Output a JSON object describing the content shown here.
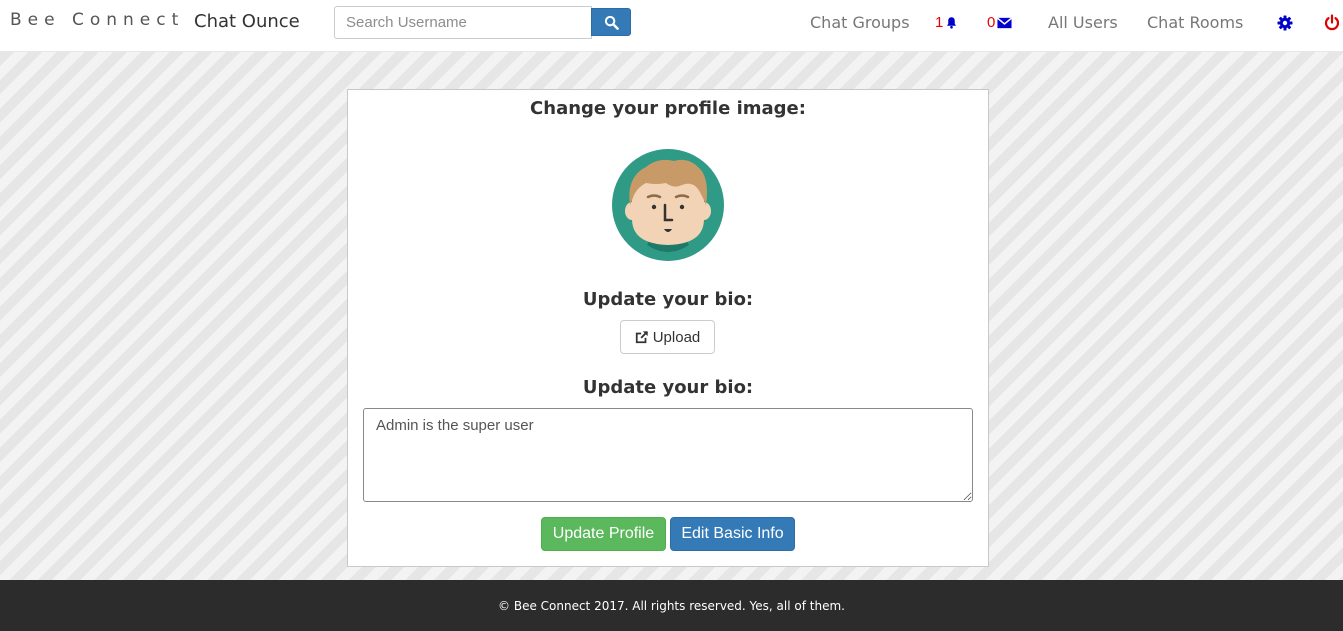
{
  "navbar": {
    "brand": "Bee Connect",
    "sub_brand": "Chat Ounce",
    "search": {
      "placeholder": "Search Username",
      "value": "",
      "icon": "search-icon"
    },
    "links": {
      "chat_groups": "Chat Groups",
      "all_users": "All Users",
      "chat_rooms": "Chat Rooms"
    },
    "notifications": {
      "count": "1",
      "icon": "bell-icon"
    },
    "messages": {
      "count": "0",
      "icon": "envelope-icon"
    },
    "settings_icon": "gear-icon",
    "logout_icon": "power-icon"
  },
  "profile": {
    "image_heading": "Change your profile image:",
    "avatar_icon": "user-avatar",
    "upload_heading": "Update your bio:",
    "upload_label": "Upload",
    "upload_icon": "share-icon",
    "bio_heading": "Update your bio:",
    "bio_value": "Admin is the super user",
    "update_button": "Update Profile",
    "edit_button": "Edit Basic Info"
  },
  "footer": {
    "text": "© Bee Connect 2017. All rights reserved. Yes, all of them."
  },
  "colors": {
    "primary": "#337ab7",
    "success": "#5cb85c",
    "alert": "#e00000",
    "icon_blue": "#0000cc",
    "footer_bg": "#2c2c2c"
  }
}
